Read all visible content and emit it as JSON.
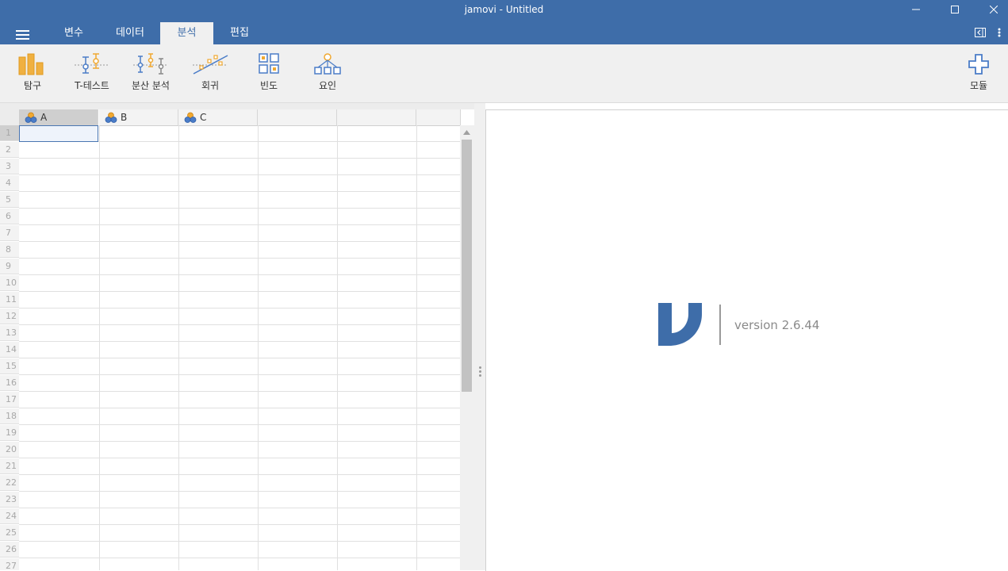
{
  "window": {
    "title": "jamovi - Untitled"
  },
  "menu": {
    "tabs": [
      {
        "label": "변수"
      },
      {
        "label": "데이터"
      },
      {
        "label": "분석"
      },
      {
        "label": "편집"
      }
    ],
    "active_tab": "분석"
  },
  "ribbon": {
    "items": [
      {
        "label": "탐구",
        "icon": "bar-chart-icon"
      },
      {
        "label": "T-테스트",
        "icon": "t-test-icon"
      },
      {
        "label": "분산 분석",
        "icon": "anova-icon"
      },
      {
        "label": "회귀",
        "icon": "regression-icon"
      },
      {
        "label": "빈도",
        "icon": "frequencies-icon"
      },
      {
        "label": "요인",
        "icon": "factor-icon"
      }
    ],
    "modules": {
      "label": "모듈",
      "icon": "plus-icon"
    }
  },
  "spreadsheet": {
    "columns": [
      {
        "name": "A",
        "icon": "nominal-variable-icon"
      },
      {
        "name": "B",
        "icon": "nominal-variable-icon"
      },
      {
        "name": "C",
        "icon": "nominal-variable-icon"
      }
    ],
    "rows": [
      "1",
      "2",
      "3",
      "4",
      "5",
      "6",
      "7",
      "8",
      "9",
      "10",
      "11",
      "12",
      "13",
      "14",
      "15",
      "16",
      "17",
      "18",
      "19",
      "20",
      "21",
      "22",
      "23",
      "24",
      "25",
      "26",
      "27"
    ],
    "selected_cell": "A1"
  },
  "results": {
    "version": "version 2.6.44"
  },
  "colors": {
    "primary": "#3e6da9",
    "ribbon_bg": "#f0f0f0",
    "accent_orange": "#f0a830",
    "icon_blue": "#4a7cc7"
  }
}
